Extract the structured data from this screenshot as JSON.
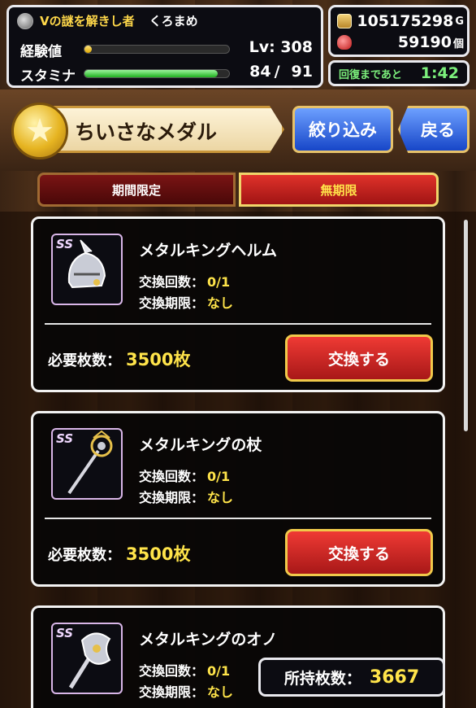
{
  "player": {
    "title": "Vの謎を解きし者",
    "name": "くろまめ"
  },
  "stats": {
    "exp_label": "経験値",
    "exp_progress": 0.05,
    "level_text": "Lv: 308",
    "stamina_label": "スタミナ",
    "stamina_current": "84",
    "stamina_sep": "/",
    "stamina_max": "91",
    "stamina_progress": 0.923
  },
  "currency": {
    "gold_value": "105175298",
    "gold_unit": "G",
    "gems_value": "59190",
    "gems_unit": "個"
  },
  "recovery": {
    "label": "回復まであと",
    "time": "1:42"
  },
  "header": {
    "title": "ちいさなメダル",
    "filter_button": "絞り込み",
    "back_button": "戻る"
  },
  "tabs": [
    {
      "label": "期間限定",
      "active": false
    },
    {
      "label": "無期限",
      "active": true
    }
  ],
  "items": [
    {
      "rank": "SS",
      "name": "メタルキングヘルム",
      "exchange_count_label": "交換回数：",
      "exchange_count": "0/1",
      "deadline_label": "交換期限：",
      "deadline": "なし",
      "cost_label": "必要枚数：",
      "cost": "3500枚",
      "button": "交換する",
      "icon": "helmet-icon"
    },
    {
      "rank": "SS",
      "name": "メタルキングの杖",
      "exchange_count_label": "交換回数：",
      "exchange_count": "0/1",
      "deadline_label": "交換期限：",
      "deadline": "なし",
      "cost_label": "必要枚数：",
      "cost": "3500枚",
      "button": "交換する",
      "icon": "staff-icon"
    },
    {
      "rank": "SS",
      "name": "メタルキングのオノ",
      "exchange_count_label": "交換回数：",
      "exchange_count": "0/1",
      "deadline_label": "交換期限：",
      "deadline": "なし",
      "icon": "axe-icon"
    }
  ],
  "owned": {
    "label": "所持枚数：",
    "value": "3667"
  }
}
